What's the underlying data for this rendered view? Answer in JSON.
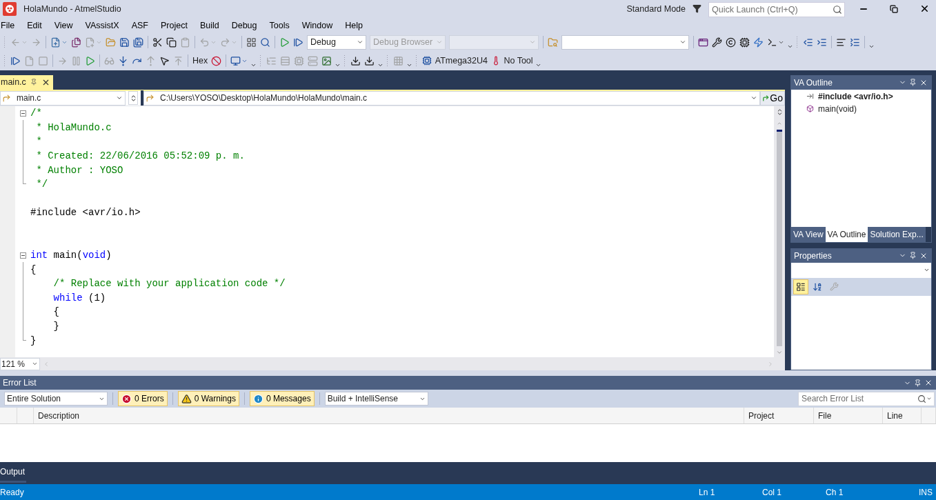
{
  "window": {
    "title": "HolaMundo - AtmelStudio",
    "mode": "Standard Mode",
    "quick_launch": {
      "placeholder": "Quick Launch (Ctrl+Q)"
    }
  },
  "menu": [
    "File",
    "Edit",
    "View",
    "VAssistX",
    "ASF",
    "Project",
    "Build",
    "Debug",
    "Tools",
    "Window",
    "Help"
  ],
  "toolbar_1": [
    {
      "kind": "grip"
    },
    {
      "kind": "split",
      "disabled": true
    },
    {
      "kind": "icon",
      "disabled": true
    },
    {
      "kind": "separator"
    },
    {
      "kind": "split",
      "disabled": false
    },
    {
      "kind": "icon",
      "disabled": false
    },
    {
      "kind": "split",
      "disabled": true
    },
    {
      "kind": "icon",
      "disabled": false
    },
    {
      "kind": "icon",
      "disabled": false
    },
    {
      "kind": "icon",
      "disabled": false
    },
    {
      "kind": "separator"
    },
    {
      "kind": "icon",
      "disabled": false
    },
    {
      "kind": "icon",
      "disabled": false
    },
    {
      "kind": "icon",
      "disabled": true
    },
    {
      "kind": "separator"
    },
    {
      "kind": "split",
      "disabled": true
    },
    {
      "kind": "split",
      "disabled": true
    },
    {
      "kind": "separator"
    },
    {
      "kind": "icon",
      "disabled": false
    },
    {
      "kind": "icon",
      "disabled": false
    },
    {
      "kind": "separator"
    },
    {
      "kind": "icon",
      "disabled": false
    },
    {
      "kind": "icon",
      "disabled": false
    },
    {
      "kind": "combo",
      "value": "Debug",
      "disabled": false,
      "wide": false
    },
    {
      "kind": "combo",
      "value": "Debug Browser",
      "disabled": true,
      "wide": false
    },
    {
      "kind": "combo",
      "disabled": true,
      "wide": false
    },
    {
      "kind": "separator"
    },
    {
      "kind": "icon",
      "disabled": false
    },
    {
      "kind": "combo",
      "disabled": false,
      "wide": true
    },
    {
      "kind": "separator"
    },
    {
      "kind": "icon",
      "disabled": false
    },
    {
      "kind": "icon",
      "disabled": false
    },
    {
      "kind": "icon",
      "disabled": false
    },
    {
      "kind": "icon",
      "disabled": false
    },
    {
      "kind": "icon",
      "disabled": false
    },
    {
      "kind": "split",
      "disabled": false
    },
    {
      "kind": "overflow"
    },
    {
      "kind": "grip"
    },
    {
      "kind": "icon",
      "disabled": false
    },
    {
      "kind": "icon",
      "disabled": false
    },
    {
      "kind": "separator"
    },
    {
      "kind": "icon",
      "disabled": false
    },
    {
      "kind": "icon",
      "disabled": false
    },
    {
      "kind": "separator"
    },
    {
      "kind": "overflow"
    }
  ],
  "toolbar_2": [
    {
      "kind": "grip"
    },
    {
      "kind": "icon",
      "disabled": false
    },
    {
      "kind": "icon",
      "disabled": true
    },
    {
      "kind": "icon",
      "disabled": true
    },
    {
      "kind": "separator"
    },
    {
      "kind": "icon",
      "disabled": true
    },
    {
      "kind": "icon",
      "disabled": true
    },
    {
      "kind": "icon",
      "disabled": false
    },
    {
      "kind": "separator"
    },
    {
      "kind": "icon",
      "disabled": true
    },
    {
      "kind": "icon",
      "disabled": false
    },
    {
      "kind": "icon",
      "disabled": false
    },
    {
      "kind": "icon",
      "disabled": true
    },
    {
      "kind": "icon",
      "disabled": false
    },
    {
      "kind": "icon",
      "disabled": true
    },
    {
      "kind": "separator"
    },
    {
      "kind": "text",
      "label": "Hex"
    },
    {
      "kind": "icon",
      "disabled": false
    },
    {
      "kind": "separator"
    },
    {
      "kind": "split",
      "disabled": false
    },
    {
      "kind": "overflow"
    },
    {
      "kind": "grip"
    },
    {
      "kind": "icon",
      "disabled": true
    },
    {
      "kind": "icon",
      "disabled": true
    },
    {
      "kind": "icon",
      "disabled": true
    },
    {
      "kind": "icon",
      "disabled": true
    },
    {
      "kind": "icon",
      "disabled": false
    },
    {
      "kind": "overflow"
    },
    {
      "kind": "grip"
    },
    {
      "kind": "icon",
      "disabled": false
    },
    {
      "kind": "icon",
      "disabled": false
    },
    {
      "kind": "overflow"
    },
    {
      "kind": "grip"
    },
    {
      "kind": "icon",
      "disabled": true
    },
    {
      "kind": "overflow"
    },
    {
      "kind": "grip"
    },
    {
      "kind": "labeled",
      "label": "ATmega32U4"
    },
    {
      "kind": "labeled",
      "label": "No Tool"
    },
    {
      "kind": "overflow"
    }
  ],
  "document_tabs": [
    {
      "label": "main.c",
      "selected": true
    }
  ],
  "navigation": {
    "scope": "main.c",
    "path": "C:\\Users\\YOSO\\Desktop\\HolaMundo\\HolaMundo\\main.c",
    "go": "Go"
  },
  "code": [
    {
      "kind": "fold_start",
      "segments": [
        {
          "kind": "comment",
          "text": "/*"
        }
      ]
    },
    {
      "kind": "fold_body",
      "segments": [
        {
          "kind": "comment",
          "text": " * HolaMundo.c"
        }
      ]
    },
    {
      "kind": "fold_body",
      "segments": [
        {
          "kind": "comment",
          "text": " *"
        }
      ]
    },
    {
      "kind": "fold_body",
      "segments": [
        {
          "kind": "comment",
          "text": " * Created: 22/06/2016 05:52:09 p. m."
        }
      ]
    },
    {
      "kind": "fold_body",
      "segments": [
        {
          "kind": "comment",
          "text": " * Author : YOSO"
        }
      ]
    },
    {
      "kind": "fold_end",
      "segments": [
        {
          "kind": "comment",
          "text": " */"
        }
      ]
    },
    {
      "kind": "blank"
    },
    {
      "kind": "plain",
      "segments": [
        {
          "kind": "plain",
          "text": "#include <avr/io.h>"
        }
      ]
    },
    {
      "kind": "blank"
    },
    {
      "kind": "blank"
    },
    {
      "kind": "fold_start",
      "segments": [
        {
          "kind": "keyword",
          "text": "int"
        },
        {
          "kind": "plain",
          "text": " main("
        },
        {
          "kind": "keyword",
          "text": "void"
        },
        {
          "kind": "plain",
          "text": ")"
        }
      ]
    },
    {
      "kind": "fold_body",
      "segments": [
        {
          "kind": "plain",
          "text": "{"
        }
      ]
    },
    {
      "kind": "fold_body",
      "segments": [
        {
          "kind": "comment",
          "text": "    /* Replace with your application code */"
        }
      ]
    },
    {
      "kind": "fold_body",
      "segments": [
        {
          "kind": "keyword",
          "text": "    while"
        },
        {
          "kind": "plain",
          "text": " (1)"
        }
      ]
    },
    {
      "kind": "fold_body",
      "segments": [
        {
          "kind": "plain",
          "text": "    {"
        }
      ]
    },
    {
      "kind": "fold_body",
      "segments": [
        {
          "kind": "plain",
          "text": "    }"
        }
      ]
    },
    {
      "kind": "fold_end",
      "segments": [
        {
          "kind": "plain",
          "text": "}"
        }
      ]
    }
  ],
  "zoom": "121 %",
  "va_outline": {
    "title": "VA Outline",
    "items": [
      {
        "kind": "include",
        "label": "#include <avr/io.h>"
      },
      {
        "kind": "function",
        "label": "main(void)"
      }
    ],
    "tabs": [
      {
        "label": "VA View",
        "selected": false
      },
      {
        "label": "VA Outline",
        "selected": true
      },
      {
        "label": "Solution Exp...",
        "selected": false
      }
    ]
  },
  "properties": {
    "title": "Properties",
    "tools": [
      {
        "kind": "categorized",
        "selected": true,
        "disabled": false
      },
      {
        "kind": "alphabetical",
        "selected": false,
        "disabled": false
      },
      {
        "kind": "pages",
        "selected": false,
        "disabled": true
      }
    ]
  },
  "error_list": {
    "title": "Error List",
    "scope": "Entire Solution",
    "filters": [
      {
        "kind": "error",
        "label": "0 Errors",
        "selected": true
      },
      {
        "kind": "warning",
        "label": "0 Warnings",
        "selected": true
      },
      {
        "kind": "info",
        "label": "0 Messages",
        "selected": true
      }
    ],
    "source": "Build + IntelliSense",
    "search": {
      "placeholder": "Search Error List"
    },
    "columns": [
      "Description",
      "Project",
      "File",
      "Line"
    ]
  },
  "output_tab": "Output",
  "status_bar": {
    "message": "Ready",
    "line": "Ln 1",
    "column": "Col 1",
    "char": "Ch 1",
    "mode": "INS"
  }
}
